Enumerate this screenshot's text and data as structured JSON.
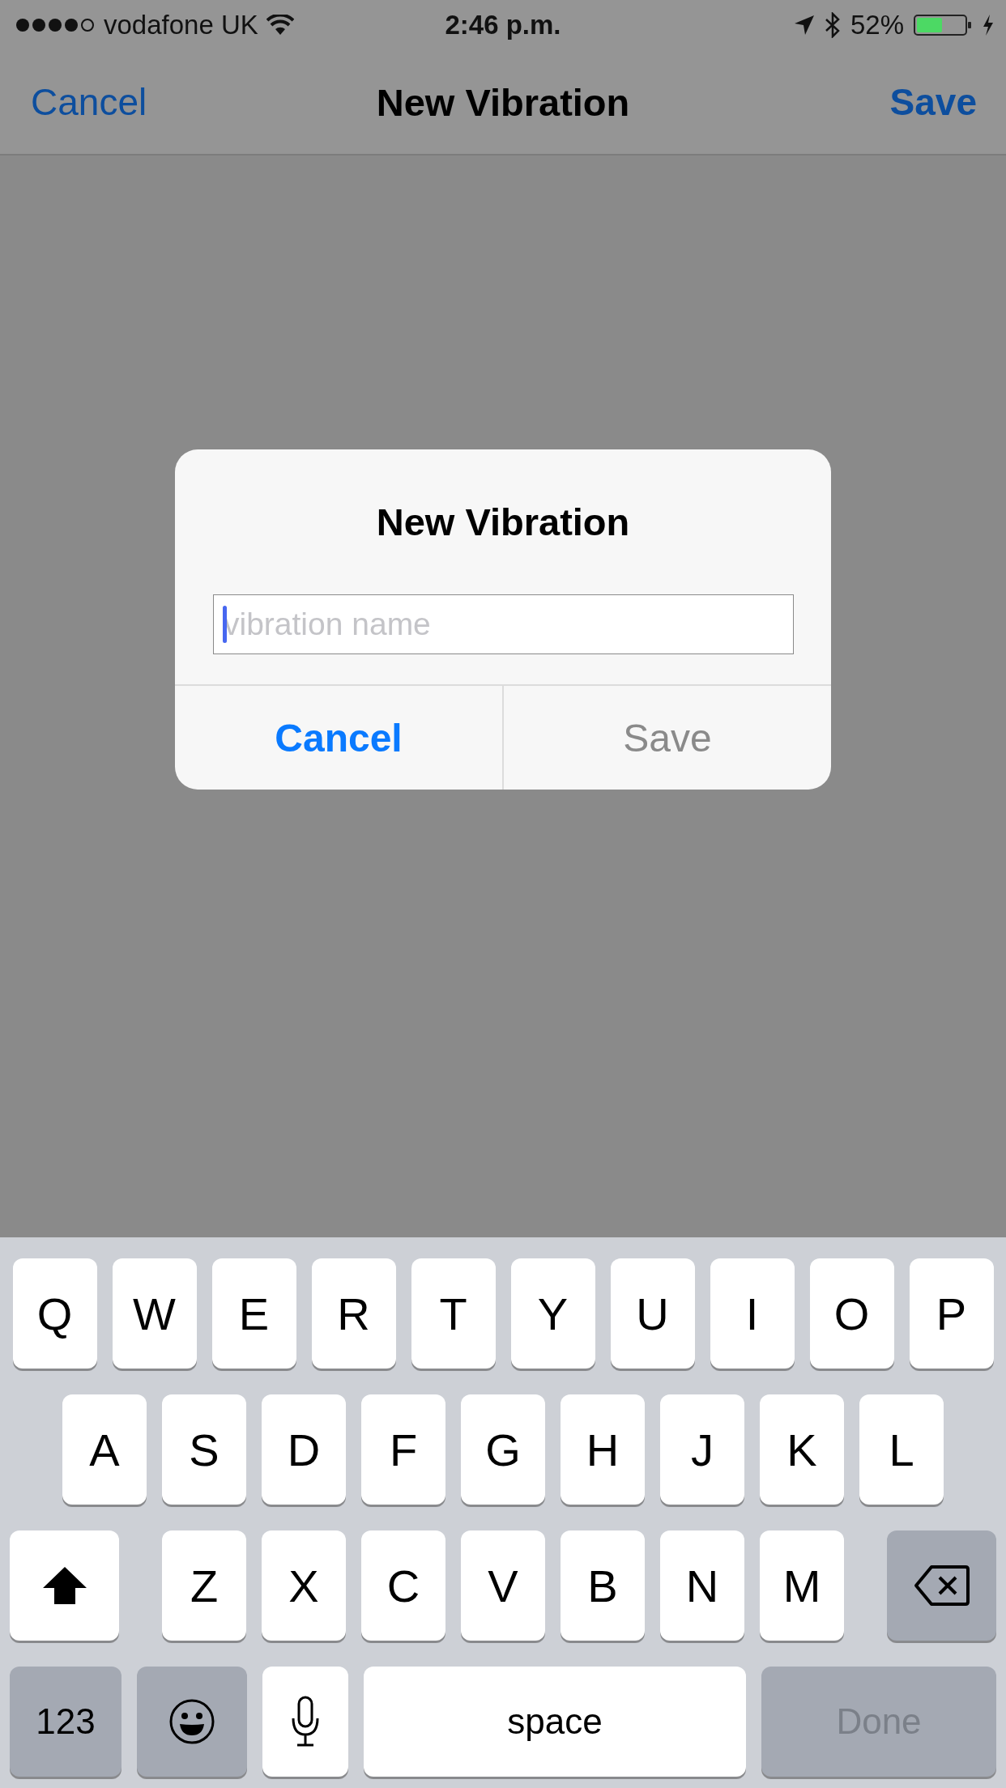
{
  "status_bar": {
    "carrier": "vodafone UK",
    "time": "2:46 p.m.",
    "battery": "52%"
  },
  "nav_bar": {
    "left": "Cancel",
    "title": "New Vibration",
    "right": "Save"
  },
  "dialog": {
    "title": "New Vibration",
    "field": {
      "placeholder": "vibration name",
      "focused": true
    },
    "buttons": [
      {
        "label": "Cancel",
        "disabled": false,
        "bold": true
      },
      {
        "label": "Save",
        "disabled": true,
        "bold": false
      }
    ]
  },
  "keyboard": {
    "rows": [
      [
        "Q",
        "W",
        "E",
        "R",
        "T",
        "Y",
        "U",
        "I",
        "O",
        "P"
      ],
      [
        "A",
        "S",
        "D",
        "F",
        "G",
        "H",
        "J",
        "K",
        "L"
      ],
      [
        "Z",
        "X",
        "C",
        "V",
        "B",
        "N",
        "M"
      ]
    ],
    "bottom_row": [
      {
        "kind": "numbers",
        "label": "123"
      },
      {
        "kind": "emoji"
      },
      {
        "kind": "mic"
      },
      {
        "kind": "space",
        "label": "space"
      },
      {
        "kind": "done",
        "label": "Done",
        "disabled": true
      }
    ]
  }
}
